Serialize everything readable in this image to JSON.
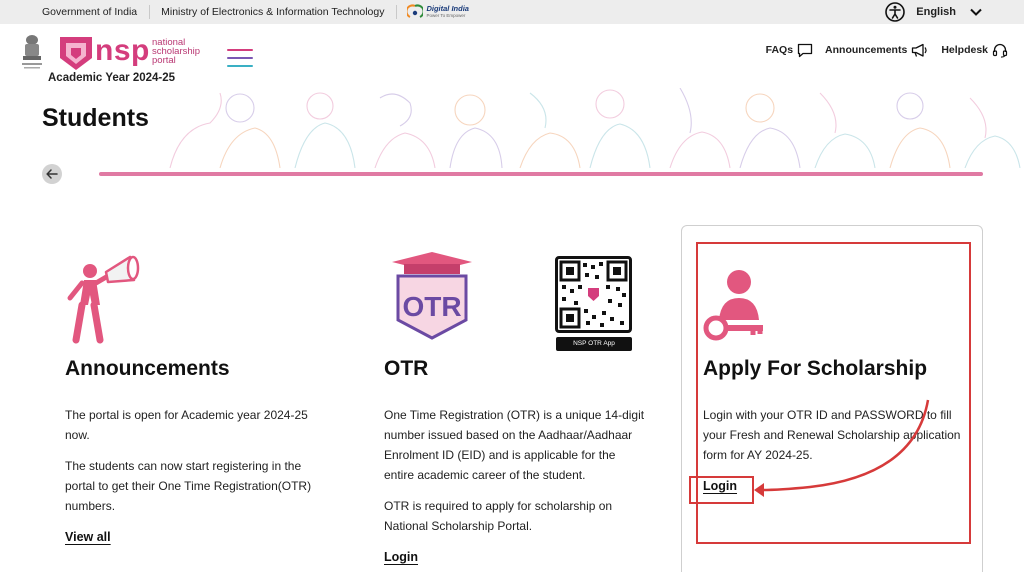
{
  "govbar": {
    "government": "Government of India",
    "ministry": "Ministry of Electronics & Information Technology",
    "digital_india": "Digital India",
    "digital_india_tagline": "Power To Empower",
    "language": "English",
    "accessibility_icon": "accessibility-icon",
    "language_icon": "chevron-down-icon"
  },
  "header": {
    "logo_word": "nsp",
    "logo_sub_1": "national",
    "logo_sub_2": "scholarship",
    "logo_sub_3": "portal",
    "academic_year": "Academic Year 2024-25",
    "nav": [
      {
        "label": "FAQs",
        "icon": "chat-icon"
      },
      {
        "label": "Announcements",
        "icon": "megaphone-icon"
      },
      {
        "label": "Helpdesk",
        "icon": "headset-icon"
      }
    ]
  },
  "banner": {
    "title": "Students",
    "back_icon": "arrow-left-icon"
  },
  "cards": {
    "announcements": {
      "title": "Announcements",
      "paragraphs": [
        "The portal is open for Academic year 2024-25 now.",
        "The students can now start registering in the portal to get their One Time Registration(OTR) numbers."
      ],
      "link": "View all",
      "icon": "megaphone-person-icon"
    },
    "otr": {
      "title": "OTR",
      "badge_text": "OTR",
      "paragraphs": [
        "One Time Registration (OTR) is a unique 14-digit number issued based on the Aadhaar/Aadhaar Enrolment ID (EID) and is applicable for the entire academic career of the student.",
        "OTR is required to apply for scholarship on National Scholarship Portal."
      ],
      "link": "Login",
      "qr_label": "NSP OTR App",
      "icon": "otr-cap-icon"
    },
    "apply": {
      "title": "Apply For Scholarship",
      "paragraph": "Login with your OTR ID and PASSWORD to fill your Fresh and Renewal Scholarship application form for AY 2024-25.",
      "link": "Login",
      "icon": "user-key-icon"
    }
  },
  "colors": {
    "brand_pink": "#d43d7d",
    "accent_line": "#e07aa3",
    "otr_purple": "#6b4aa3",
    "annotation_red": "#d63a3a"
  }
}
